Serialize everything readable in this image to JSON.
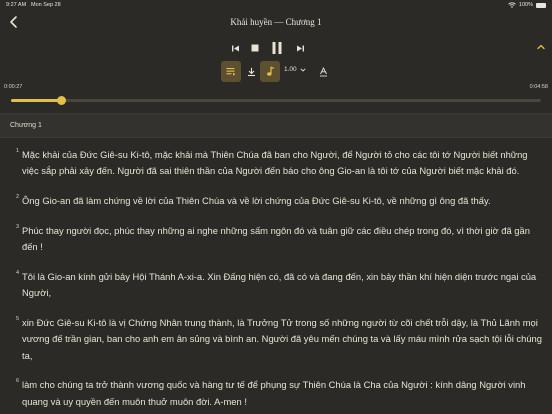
{
  "status": {
    "time": "9:27 AM",
    "date": "Mon Sep 28",
    "battery": "100%"
  },
  "header": {
    "title": "Khải huyền — Chương 1"
  },
  "player": {
    "speed": "1.00",
    "elapsed": "0:00:27",
    "duration": "0:04:58",
    "progress_fraction": 0.095,
    "accent_color": "#e4c04a"
  },
  "chapter": {
    "label": "Chương 1"
  },
  "verses": [
    {
      "num": "1",
      "text": "Mặc khải của Đức Giê-su Ki-tô, mặc khải mà Thiên Chúa đã ban cho Người, để Người tỏ cho các tôi tớ Người biết những việc sắp phải xảy đến. Người đã sai thiên thần của Người đến báo cho ông Gio-an là tôi tớ của Người biết mặc khải đó."
    },
    {
      "num": "2",
      "text": "Ông Gio-an đã làm chứng về lời của Thiên Chúa và về lời chứng của Đức Giê-su Ki-tô, về những gì ông đã thấy."
    },
    {
      "num": "3",
      "text": "Phúc thay người đọc, phúc thay những ai nghe những sấm ngôn đó và tuân giữ các điều chép trong đó, vì thời giờ đã gần đến !"
    },
    {
      "num": "4",
      "text": "Tôi là Gio-an kính gửi bảy Hội Thánh A-xi-a. Xin Đấng hiện có, đã có và đang đến, xin bảy thần khí hiện diện trước ngai của Người,"
    },
    {
      "num": "5",
      "text": "xin Đức Giê-su Ki-tô là vị Chứng Nhân trung thành, là Trưởng Tử trong số những người từ cõi chết trỗi dậy, là Thủ Lãnh mọi vương đế trần gian, ban cho anh em ân sủng và bình an. Người đã yêu mến chúng ta và lấy máu mình rửa sạch tội lỗi chúng ta,"
    },
    {
      "num": "6",
      "text": "làm cho chúng ta trở thành vương quốc và hàng tư tế để phụng sự Thiên Chúa là Cha của Người : kính dâng Người vinh quang và uy quyền đến muôn thuở muôn đời. A-men !"
    }
  ]
}
